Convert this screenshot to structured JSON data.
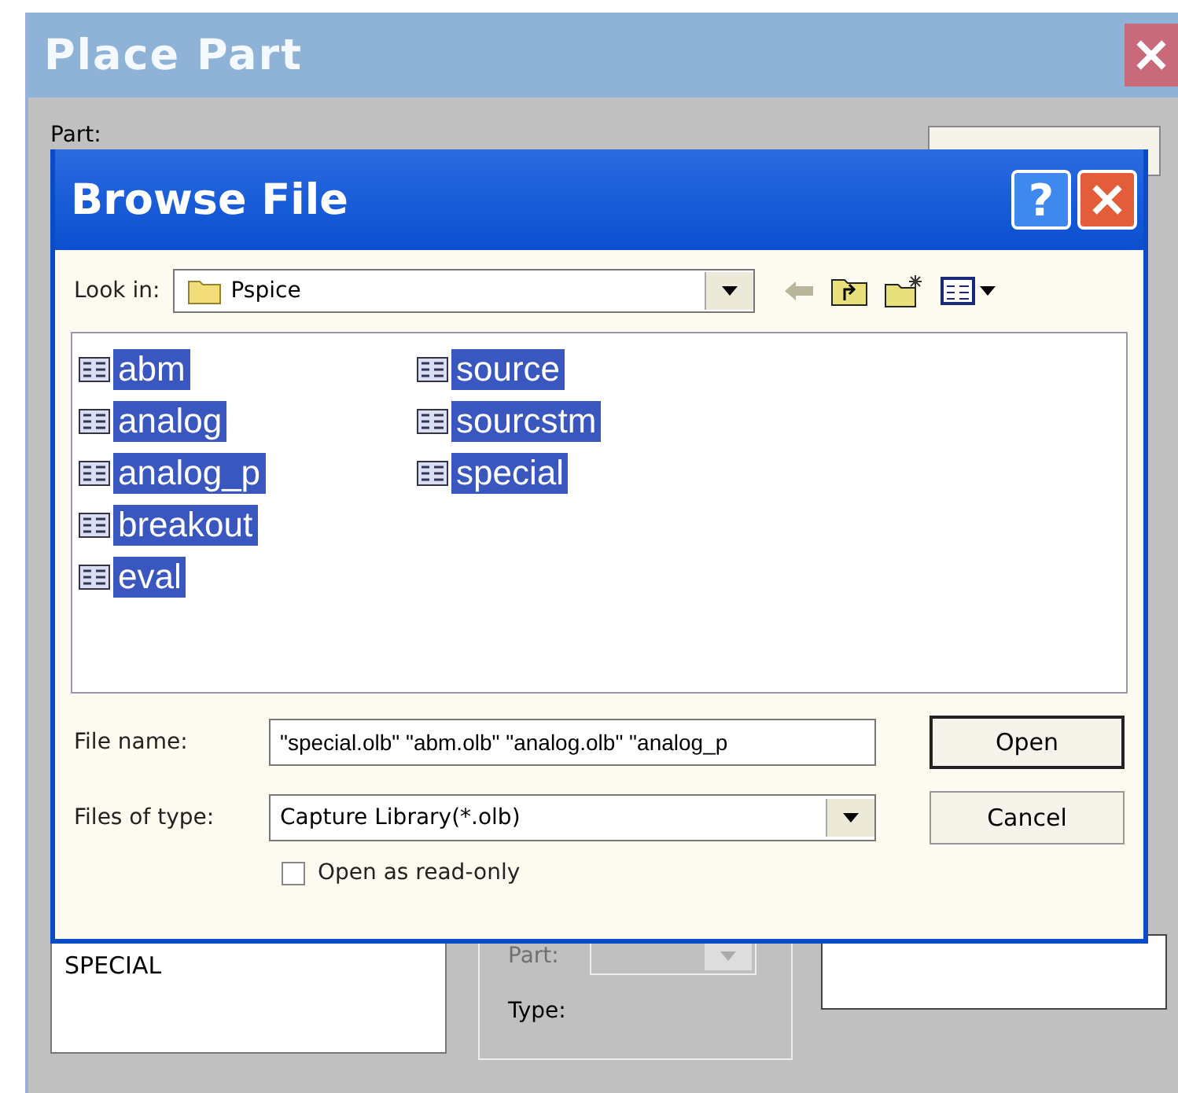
{
  "place_part": {
    "title": "Place Part",
    "part_label": "Part:",
    "library_list": [
      "SPECIAL"
    ],
    "group": {
      "part_label": "Part:",
      "part_disabled": true,
      "type_label": "Type:"
    }
  },
  "browse_file": {
    "title": "Browse File",
    "help_label": "?",
    "look_in": {
      "label": "Look in:",
      "value": "Pspice"
    },
    "files": [
      {
        "name": "abm",
        "selected": true
      },
      {
        "name": "analog",
        "selected": true
      },
      {
        "name": "analog_p",
        "selected": true
      },
      {
        "name": "breakout",
        "selected": true
      },
      {
        "name": "eval",
        "selected": true
      },
      {
        "name": "source",
        "selected": true
      },
      {
        "name": "sourcstm",
        "selected": true
      },
      {
        "name": "special",
        "selected": true
      }
    ],
    "file_name": {
      "label": "File name:",
      "value": "\"special.olb\" \"abm.olb\" \"analog.olb\" \"analog_p"
    },
    "files_of_type": {
      "label": "Files of type:",
      "value": "Capture Library(*.olb)"
    },
    "read_only": {
      "label": "Open as read-only",
      "checked": false
    },
    "buttons": [
      {
        "label": "Open",
        "default": true
      },
      {
        "label": "Cancel",
        "default": false
      }
    ]
  }
}
